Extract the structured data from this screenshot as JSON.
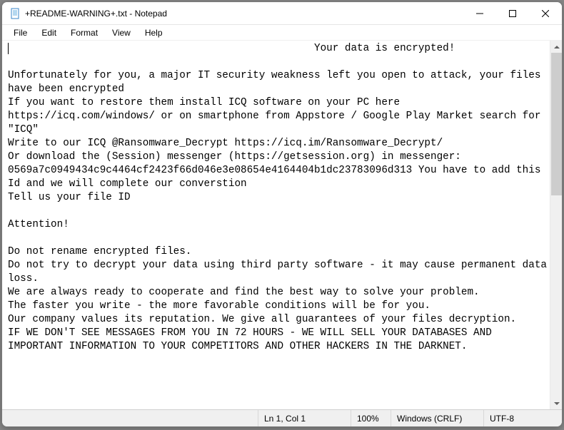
{
  "titlebar": {
    "title": "+README-WARNING+.txt - Notepad"
  },
  "menubar": {
    "items": [
      "File",
      "Edit",
      "Format",
      "View",
      "Help"
    ]
  },
  "content": {
    "text": "                                                  Your data is encrypted!\n\nUnfortunately for you, a major IT security weakness left you open to attack, your files have been encrypted\nIf you want to restore them install ICQ software on your PC here https://icq.com/windows/ or on smartphone from Appstore / Google Play Market search for \"ICQ\"\nWrite to our ICQ @Ransomware_Decrypt https://icq.im/Ransomware_Decrypt/\nOr download the (Session) messenger (https://getsession.org) in messenger: 0569a7c0949434c9c4464cf2423f66d046e3e08654e4164404b1dc23783096d313 You have to add this Id and we will complete our converstion\nTell us your file ID\n\nAttention!\n\nDo not rename encrypted files.\nDo not try to decrypt your data using third party software - it may cause permanent data loss.\nWe are always ready to cooperate and find the best way to solve your problem.\nThe faster you write - the more favorable conditions will be for you.\nOur company values its reputation. We give all guarantees of your files decryption.\nIF WE DON'T SEE MESSAGES FROM YOU IN 72 HOURS - WE WILL SELL YOUR DATABASES AND IMPORTANT INFORMATION TO YOUR COMPETITORS AND OTHER HACKERS IN THE DARKNET."
  },
  "statusbar": {
    "position": "Ln 1, Col 1",
    "zoom": "100%",
    "lineending": "Windows (CRLF)",
    "encoding": "UTF-8"
  }
}
